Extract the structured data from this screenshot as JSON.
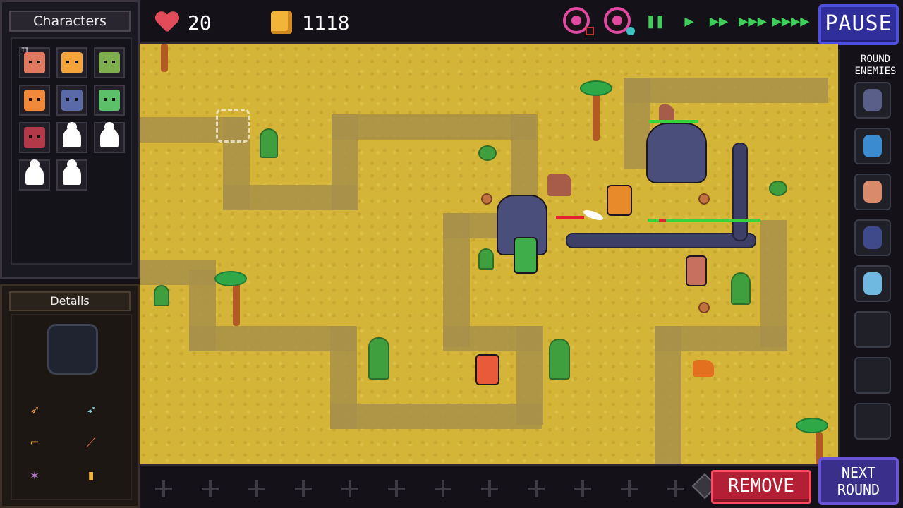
{
  "left_panel": {
    "characters_title": "Characters",
    "details_title": "Details",
    "characters": [
      {
        "name": "bearded-hero",
        "color": "#e07a5f",
        "badge": "II"
      },
      {
        "name": "orange-knight",
        "color": "#f4a43a"
      },
      {
        "name": "green-rogue",
        "color": "#7fae4f"
      },
      {
        "name": "red-haired-girl",
        "color": "#f08a3a"
      },
      {
        "name": "blue-wizard",
        "color": "#5a6aa8"
      },
      {
        "name": "green-elf",
        "color": "#5cbf6a"
      },
      {
        "name": "dark-haired-girl",
        "color": "#b23a48"
      },
      {
        "name": "locked",
        "color": "#ffffff"
      },
      {
        "name": "locked",
        "color": "#ffffff"
      },
      {
        "name": "locked",
        "color": "#ffffff"
      },
      {
        "name": "locked",
        "color": "#ffffff"
      }
    ],
    "equipment_icons": [
      "bow-icon",
      "crossbow-icon",
      "boot-icon",
      "dagger-icon",
      "claw-icon",
      "coins-icon"
    ]
  },
  "hud": {
    "lives": "20",
    "gold": "1118"
  },
  "buttons": {
    "pause": "PAUSE",
    "remove": "REMOVE",
    "next_round_line1": "NEXT",
    "next_round_line2": "ROUND"
  },
  "rail": {
    "title_line1": "ROUND",
    "title_line2": "ENEMIES",
    "enemies": [
      {
        "name": "armored-worm",
        "color": "#5a5f8a"
      },
      {
        "name": "blue-beetle",
        "color": "#3b8bd0"
      },
      {
        "name": "flesh-golem",
        "color": "#d98a6a"
      },
      {
        "name": "dark-scorpion",
        "color": "#3f4a8a"
      },
      {
        "name": "winged-bug",
        "color": "#6fb8e0"
      }
    ],
    "empty_slots": 3
  },
  "colors": {
    "sand": "#d4b537",
    "path": "#a8904a",
    "pause_blue": "#2f2e9a",
    "remove_red": "#b31f34",
    "next_purple": "#3a2f8a",
    "speed_green": "#3ecf5a",
    "eye_pink": "#e04aa0"
  }
}
